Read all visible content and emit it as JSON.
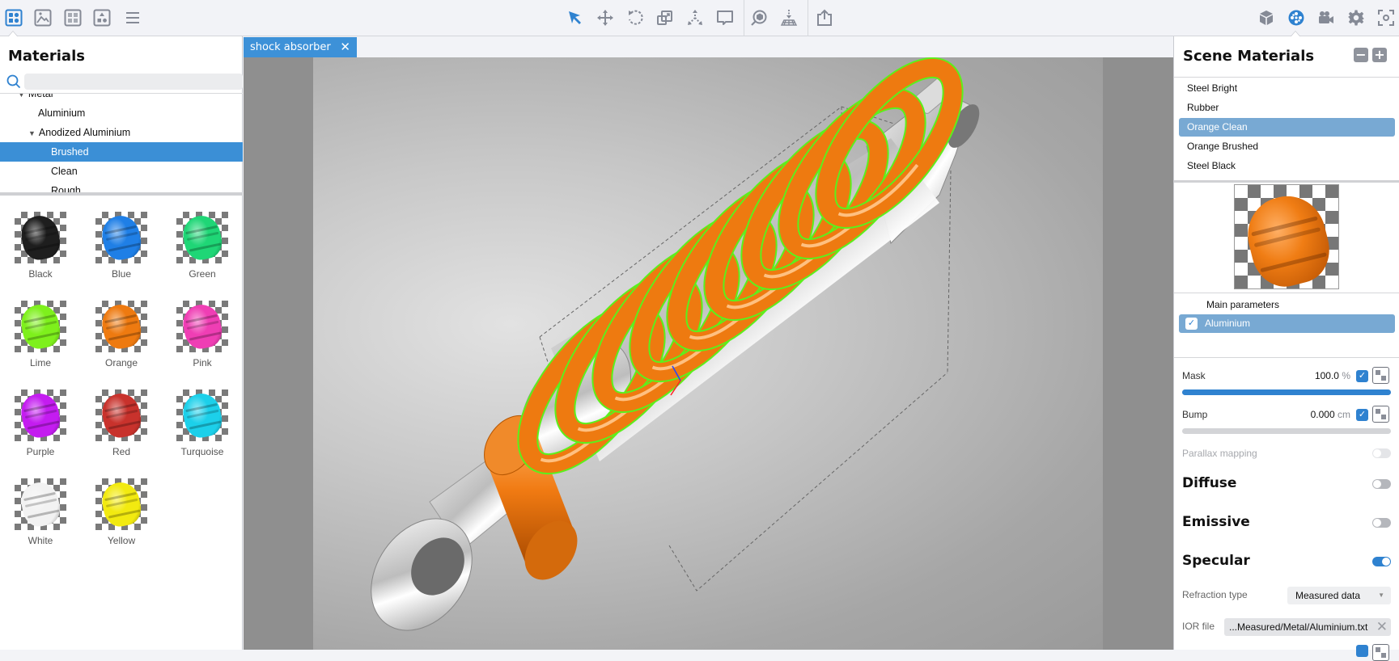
{
  "toolbar": {
    "left_icons": [
      "materials-library-icon",
      "image-icon",
      "textures-icon",
      "scene-shapes-icon",
      "menu-icon"
    ],
    "center_icons": [
      "select-arrow-icon",
      "move-icon",
      "rotate-icon",
      "scale-icon",
      "pivot-icon",
      "annotation-icon",
      "inspect-icon",
      "drop-to-floor-icon",
      "export-icon"
    ],
    "right_icons": [
      "scene-object-icon",
      "material-icon",
      "camera-icon",
      "settings-icon",
      "screenshot-icon"
    ],
    "active_left": "materials-library-icon",
    "active_right": "material-icon",
    "accent": "#2f82d0"
  },
  "library": {
    "title": "Materials",
    "search": {
      "value": "",
      "placeholder": ""
    },
    "tree": [
      {
        "label": "Metal",
        "level": 1,
        "expanded": true,
        "partial": true
      },
      {
        "label": "Aluminium",
        "level": 2
      },
      {
        "label": "Anodized Aluminium",
        "level": 2,
        "expanded": true
      },
      {
        "label": "Brushed",
        "level": 3,
        "selected": true
      },
      {
        "label": "Clean",
        "level": 3
      },
      {
        "label": "Rough",
        "level": 3,
        "partial": true
      }
    ],
    "swatches": [
      {
        "name": "Black",
        "color": "#1e1e1e"
      },
      {
        "name": "Blue",
        "color": "#1f7fe6"
      },
      {
        "name": "Green",
        "color": "#1fd676"
      },
      {
        "name": "Lime",
        "color": "#7ef01c"
      },
      {
        "name": "Orange",
        "color": "#ee7a10"
      },
      {
        "name": "Pink",
        "color": "#ef3eb4"
      },
      {
        "name": "Purple",
        "color": "#c41cf0"
      },
      {
        "name": "Red",
        "color": "#c8322c"
      },
      {
        "name": "Turquoise",
        "color": "#1cd0ea"
      },
      {
        "name": "White",
        "color": "#f2f2f2"
      },
      {
        "name": "Yellow",
        "color": "#f2ea10"
      }
    ]
  },
  "document": {
    "tab_label": "shock absorber",
    "close_glyph": "✕"
  },
  "scene_materials": {
    "title": "Scene Materials",
    "remove_label": "−",
    "add_label": "+",
    "items": [
      {
        "label": "Steel Bright"
      },
      {
        "label": "Rubber"
      },
      {
        "label": "Orange Clean",
        "selected": true
      },
      {
        "label": "Orange Brushed"
      },
      {
        "label": "Steel Black"
      }
    ],
    "preview_material": "Orange Clean",
    "main_parameters_label": "Main parameters",
    "layer": {
      "label": "Aluminium",
      "checked": true
    },
    "mask": {
      "label": "Mask",
      "value": "100.0",
      "unit": "%",
      "checked": true,
      "fraction": 1.0
    },
    "bump": {
      "label": "Bump",
      "value": "0.000",
      "unit": "cm",
      "checked": true,
      "fraction": 0.0
    },
    "parallax": {
      "label": "Parallax mapping",
      "enabled": false,
      "disabled": true
    },
    "diffuse": {
      "label": "Diffuse",
      "enabled": false
    },
    "emissive": {
      "label": "Emissive",
      "enabled": false
    },
    "specular": {
      "label": "Specular",
      "enabled": true
    },
    "refraction": {
      "label": "Refraction type",
      "value": "Measured data"
    },
    "ior": {
      "label": "IOR file",
      "value": "...Measured/Metal/Aluminium.txt"
    }
  },
  "colors": {
    "selection_blue": "#3b8fd6",
    "list_selection": "#78a9d3",
    "spring_orange": "#ee7a10",
    "highlight_outline": "#5cf01c"
  }
}
